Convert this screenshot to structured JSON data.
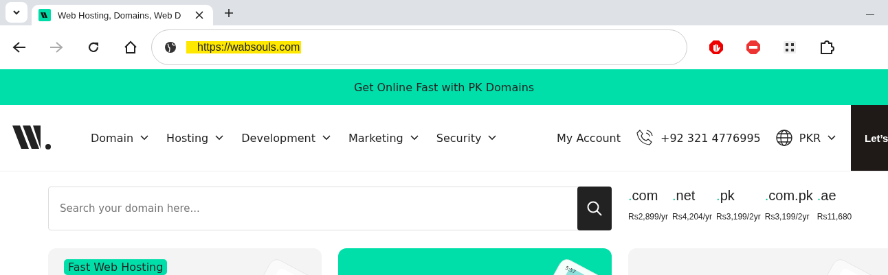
{
  "browser": {
    "tab": {
      "title": "Web Hosting, Domains, Web D",
      "selected": true
    },
    "address": "https://wabsouls.com",
    "forward_disabled": true
  },
  "banner": {
    "text": "Get Online Fast with PK Domains"
  },
  "nav": {
    "items": [
      {
        "label": "Domain"
      },
      {
        "label": "Hosting"
      },
      {
        "label": "Development"
      },
      {
        "label": "Marketing"
      },
      {
        "label": "Security"
      }
    ],
    "account": "My Account",
    "phone": "+92 321 4776995",
    "currency": "PKR",
    "cta": "Let’s"
  },
  "search": {
    "placeholder": "Search your domain here..."
  },
  "tlds": [
    {
      "dot": ".",
      "name": "com",
      "price": "Rs2,899/yr"
    },
    {
      "dot": ".",
      "name": "net",
      "price": "Rs4,204/yr"
    },
    {
      "dot": ".",
      "name": "pk",
      "price": "Rs3,199/2yr"
    },
    {
      "dot": ".",
      "name": "com.pk",
      "price": "Rs3,199/2yr"
    },
    {
      "dot": ".",
      "name": "ae",
      "price": "Rs11,680"
    }
  ],
  "cards": [
    {
      "kind": "grey",
      "badge": "Fast Web Hosting"
    },
    {
      "kind": "green",
      "phone_time": "5:57"
    },
    {
      "kind": "grey"
    }
  ]
}
